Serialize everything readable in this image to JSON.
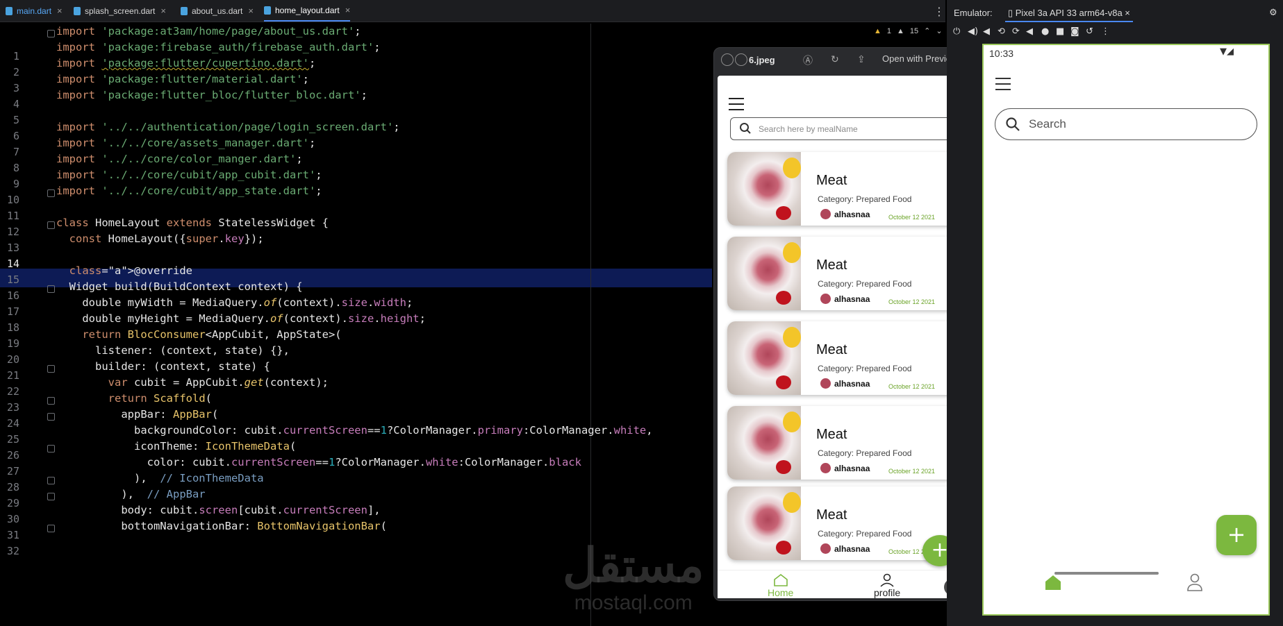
{
  "editor": {
    "tabs": [
      {
        "label": "main.dart"
      },
      {
        "label": "splash_screen.dart"
      },
      {
        "label": "about_us.dart"
      },
      {
        "label": "home_layout.dart"
      }
    ],
    "current_line": "14",
    "indicators": {
      "warnings": "1",
      "weak_warnings": "15"
    },
    "code_lines": [
      "import 'package:at3am/home/page/about_us.dart';",
      "import 'package:firebase_auth/firebase_auth.dart';",
      "import 'package:flutter/cupertino.dart';",
      "import 'package:flutter/material.dart';",
      "import 'package:flutter_bloc/flutter_bloc.dart';",
      "",
      "import '../../authentication/page/login_screen.dart';",
      "import '../../core/assets_manager.dart';",
      "import '../../core/color_manger.dart';",
      "import '../../core/cubit/app_cubit.dart';",
      "import '../../core/cubit/app_state.dart';",
      "",
      "class HomeLayout extends StatelessWidget {",
      "  const HomeLayout({super.key});",
      "",
      "  @override",
      "  Widget build(BuildContext context) {",
      "    double myWidth = MediaQuery.of(context).size.width;",
      "    double myHeight = MediaQuery.of(context).size.height;",
      "    return BlocConsumer<AppCubit, AppState>(",
      "      listener: (context, state) {},",
      "      builder: (context, state) {",
      "        var cubit = AppCubit.get(context);",
      "        return Scaffold(",
      "          appBar: AppBar(",
      "            backgroundColor: cubit.currentScreen==1?ColorManager.primary:ColorManager.white,",
      "            iconTheme: IconThemeData(",
      "              color: cubit.currentScreen==1?ColorManager.white:ColorManager.black",
      "            ),  // IconThemeData",
      "          ),  // AppBar",
      "          body: cubit.screen[cubit.currentScreen],",
      "          bottomNavigationBar: BottomNavigationBar("
    ]
  },
  "preview": {
    "title": "6.jpeg",
    "open_with": "Open with Preview",
    "search_placeholder": "Search here by mealName",
    "cards": [
      {
        "title": "Meat",
        "category": "Category: Prepared Food",
        "user": "alhasnaa",
        "date": "October 12 2021"
      },
      {
        "title": "Meat",
        "category": "Category: Prepared Food",
        "user": "alhasnaa",
        "date": "October 12 2021"
      },
      {
        "title": "Meat",
        "category": "Category: Prepared Food",
        "user": "alhasnaa",
        "date": "October 12 2021"
      },
      {
        "title": "Meat",
        "category": "Category: Prepared Food",
        "user": "alhasnaa",
        "date": "October 12 2021"
      },
      {
        "title": "Meat",
        "category": "Category: Prepared Food",
        "user": "alhasnaa",
        "date": "October 12 2021"
      }
    ],
    "fab": "+",
    "nav": {
      "home": "Home",
      "profile": "profile"
    }
  },
  "emulator": {
    "label": "Emulator:",
    "device": "Pixel 3a API 33 arm64-v8a",
    "time": "10:33",
    "search_placeholder": "Search",
    "fab": "+"
  },
  "watermark": {
    "arabic": "مستقل",
    "latin": "mostaql.com"
  },
  "colors": {
    "accent": "#7cb83f",
    "editor_bg": "#000000",
    "highlight": "#0d1b55",
    "tab_active": "#4a88f0"
  }
}
